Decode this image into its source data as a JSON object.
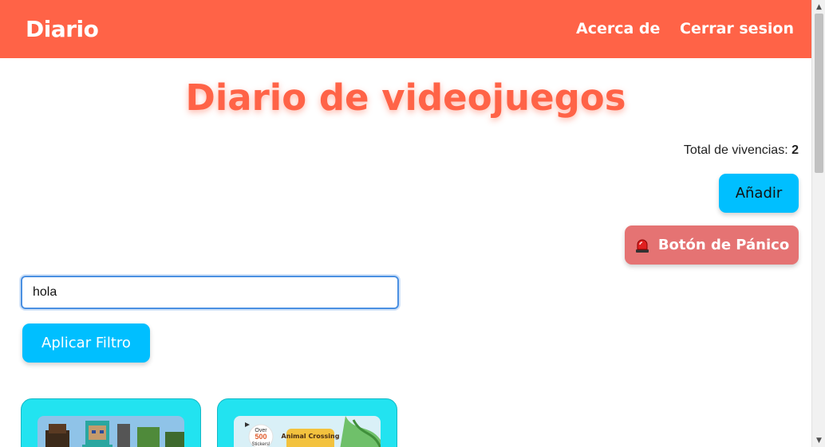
{
  "navbar": {
    "brand": "Diario",
    "links": [
      "Acerca de",
      "Cerrar sesion"
    ]
  },
  "page_title": "Diario de videojuegos",
  "stats": {
    "total_label": "Total de vivencias:",
    "total_value": "2"
  },
  "actions": {
    "add_label": "Añadir",
    "panic_label": "Botón de Pánico",
    "panic_icon": "siren-icon"
  },
  "filter": {
    "value": "hola",
    "apply_label": "Aplicar Filtro"
  },
  "cards": [
    {
      "image": "minecraft-cover"
    },
    {
      "image": "animal-crossing-cover",
      "badge_text": [
        "Over",
        "500",
        "Stickers!"
      ],
      "logo_text": "Animal Crossing"
    }
  ],
  "colors": {
    "navbar": "#ff6347",
    "title": "#ff6347",
    "primary_button": "#00bfff",
    "panic_button": "#e57373",
    "card": "#22e3f0"
  }
}
